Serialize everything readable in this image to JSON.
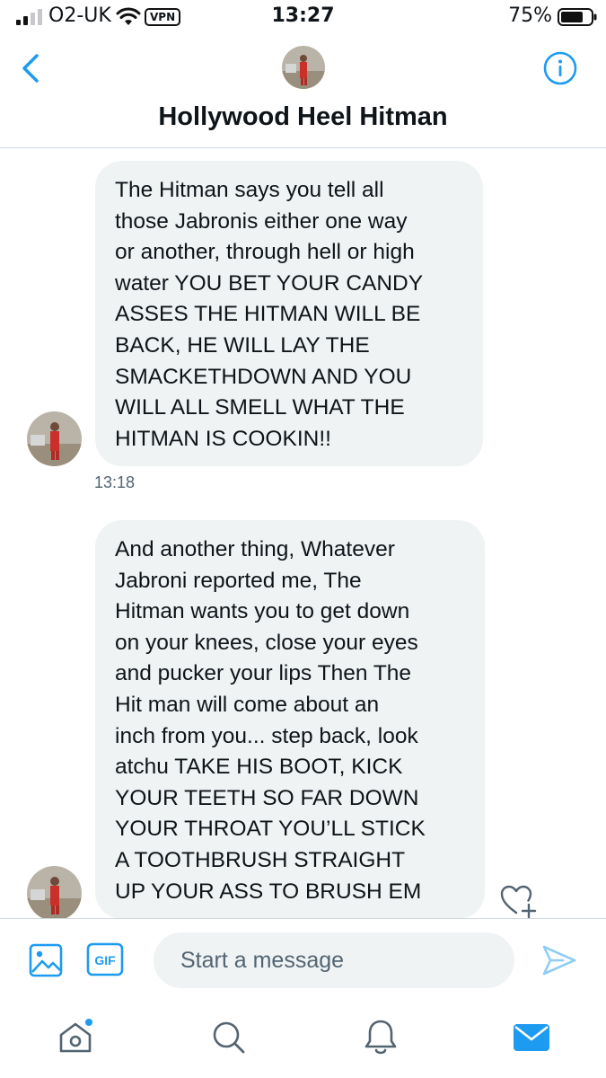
{
  "status_bar": {
    "carrier": "O2-UK",
    "vpn_label": "VPN",
    "time": "13:27",
    "battery_percent": "75%",
    "battery_level": 0.75,
    "signal_bars": 2
  },
  "header": {
    "title": "Hollywood Heel Hitman",
    "back_icon": "chevron-left-icon",
    "info_icon": "info-icon"
  },
  "messages": [
    {
      "text": "The Hitman says you tell all\nthose Jabronis either one way\nor another, through hell or high\nwater YOU BET YOUR CANDY\nASSES THE HITMAN WILL BE\nBACK, HE WILL LAY THE\nSMACKETHDOWN AND YOU\nWILL ALL SMELL WHAT THE\nHITMAN IS COOKIN!!",
      "timestamp": "13:18"
    },
    {
      "text": "And another thing, Whatever\nJabroni reported me, The\nHitman wants you to get down\non your knees, close your eyes\nand pucker your lips Then The\nHit man will come about an\ninch from you... step back, look\natchu TAKE HIS BOOT, KICK\nYOUR TEETH SO FAR DOWN\nYOUR THROAT YOU’LL STICK\nA TOOTHBRUSH STRAIGHT\nUP YOUR ASS TO BRUSH EM"
    }
  ],
  "composer": {
    "placeholder": "Start a message",
    "gif_label": "GIF"
  },
  "tabs": [
    "home",
    "search",
    "notifications",
    "messages"
  ],
  "colors": {
    "accent": "#1d9bf0",
    "bubble_bg": "#eff3f4",
    "text": "#0f1419",
    "muted": "#536471",
    "divider": "#cfd9de"
  }
}
